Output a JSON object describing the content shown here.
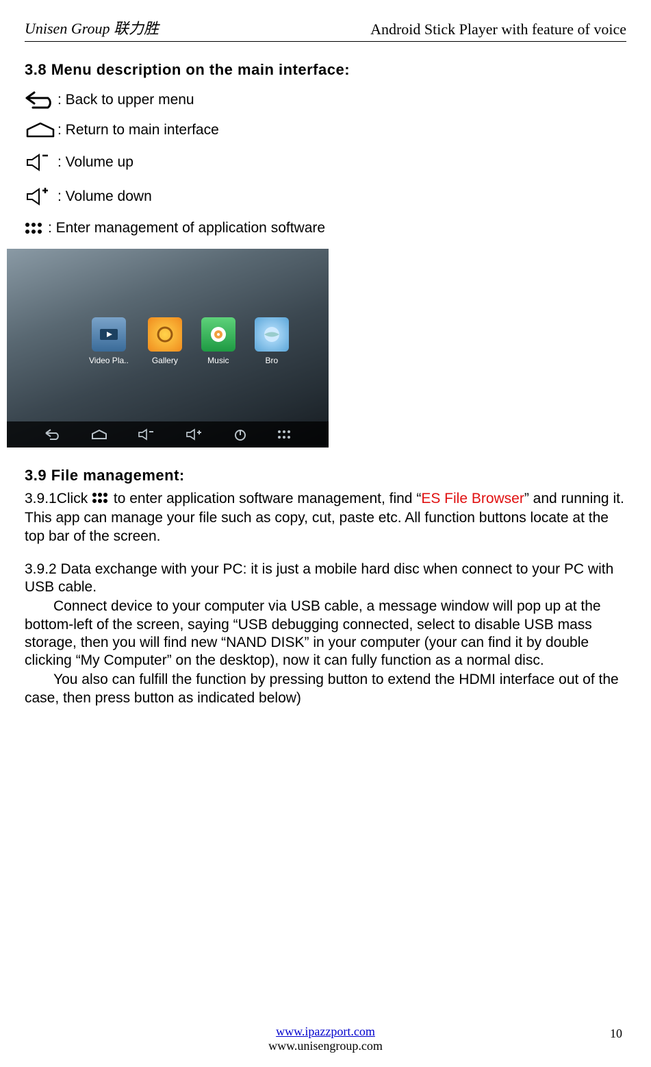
{
  "header": {
    "left": "Unisen Group  联力胜",
    "right": "Android Stick Player with feature of voice"
  },
  "section38": {
    "title": "3.8 Menu description on the main interface:",
    "items": [
      {
        "label": ": Back to upper menu"
      },
      {
        "label": ": Return to main interface"
      },
      {
        "label": ": Volume up"
      },
      {
        "label": ": Volume down"
      },
      {
        "label": ": Enter management of application software"
      }
    ]
  },
  "screenshot": {
    "apps": [
      {
        "label": "Video Pla.."
      },
      {
        "label": "Gallery"
      },
      {
        "label": "Music"
      },
      {
        "label": "Bro"
      }
    ]
  },
  "section39": {
    "title": "3.9   File management:",
    "p391_a": "3.9.1Click ",
    "p391_b": "  to  enter application software management, find “",
    "p391_red": "ES File Browser",
    "p391_c": "” and running it. This app can manage your file such as copy, cut, paste etc. All function buttons locate at the top bar of the screen.",
    "p392_a": "3.9.2 Data exchange with your PC: it is just a mobile  hard disc when connect to your PC with USB cable.",
    "p392_b": "Connect device to your computer via USB cable, a message window will pop up at the bottom-left of the screen, saying “USB debugging connected, select to disable USB mass storage, then you will find new “NAND DISK” in your computer (your can find it by double clicking “My Computer” on the desktop), now it can fully function as a normal disc.",
    "p392_c": "You also can fulfill the function by pressing button to extend the HDMI interface out of the case, then press button as indicated below)"
  },
  "footer": {
    "url1": "www.ipazzport.com",
    "url2": "www.unisengroup.com",
    "page": "10"
  }
}
